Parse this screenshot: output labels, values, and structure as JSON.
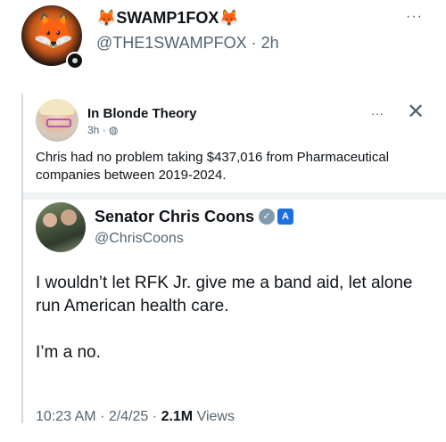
{
  "post": {
    "display_name": "SWAMP1FOX",
    "name_emoji_left": "🦊",
    "name_emoji_right": "🦊",
    "avatar_text": "SWAMP1FOX",
    "handle": "@THE1SWAMPFOX",
    "time": "2h",
    "separator": "·",
    "more": "···"
  },
  "quoted_post": {
    "author": "In Blonde Theory",
    "time": "3h",
    "separator": "·",
    "more": "···",
    "close": "✕",
    "text": "Chris had no problem taking $437,016 from Pharmaceutical companies between 2019-2024."
  },
  "embedded_tweet": {
    "author": "Senator Chris Coons",
    "handle": "@ChrisCoons",
    "verified_icon": "✓",
    "gov_icon": "A",
    "body_line1": "I wouldn’t let RFK Jr. give me a band aid, let alone run American health care.",
    "body_line2": "I’m a no.",
    "time": "10:23 AM",
    "date": "2/4/25",
    "separator": "·",
    "views_count": "2.1M",
    "views_label": "Views"
  },
  "colors": {
    "text_primary": "#0f1419",
    "text_secondary": "#536471",
    "verified_grey": "#829aab",
    "gov_blue": "#1d6fe0"
  }
}
